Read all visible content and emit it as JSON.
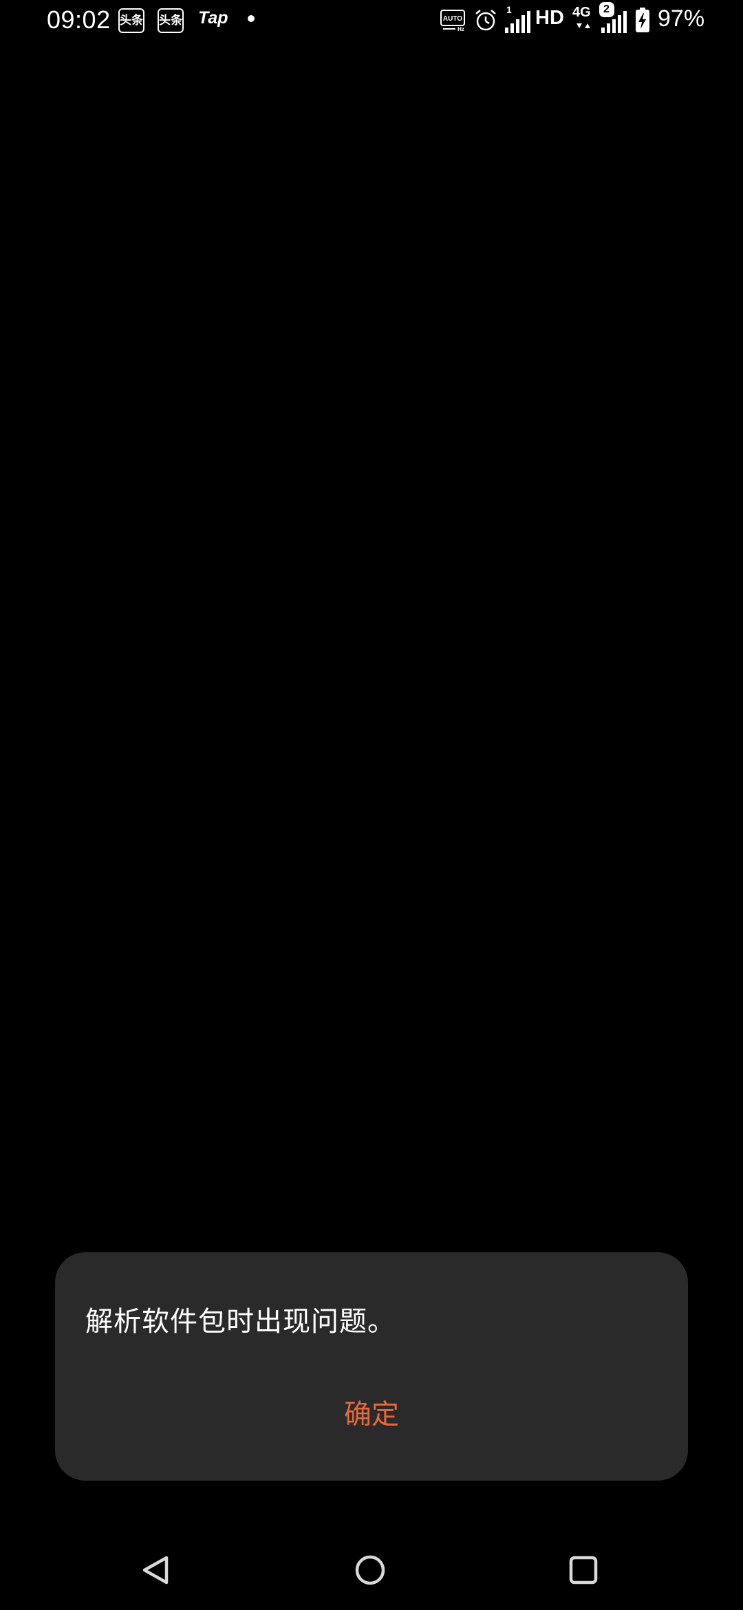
{
  "status_bar": {
    "time": "09:02",
    "notif_badges": [
      "头条",
      "头条"
    ],
    "tap_label": "Tap",
    "hd_label": "HD",
    "network_label": "4G",
    "sim1_label": "1",
    "sim2_label": "2",
    "battery_text": "97%",
    "icons": [
      "toutiao-icon",
      "toutiao-icon",
      "taptap-icon",
      "dot-icon",
      "auto-hz-icon",
      "alarm-icon",
      "signal-icon",
      "signal-icon",
      "battery-charging-icon"
    ]
  },
  "dialog": {
    "message": "解析软件包时出现问题。",
    "confirm_label": "确定",
    "accent_color": "#e4693c",
    "background_color": "#2a2a2a"
  },
  "nav_bar": {
    "icons": [
      "back-icon",
      "home-icon",
      "recents-icon"
    ]
  }
}
